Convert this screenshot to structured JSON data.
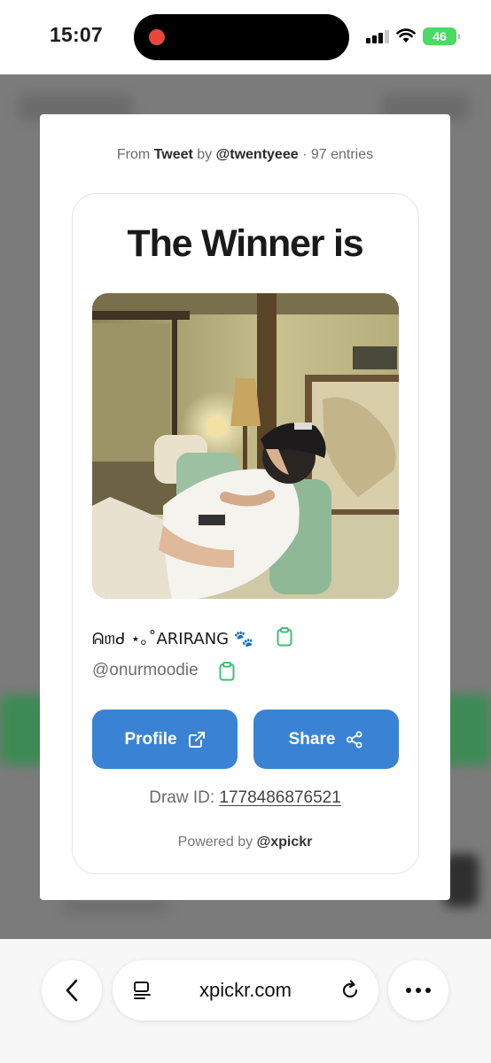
{
  "status_bar": {
    "time": "15:07",
    "battery": "46"
  },
  "modal": {
    "source": {
      "from": "From",
      "platform": "Tweet",
      "by": "by",
      "author": "@twentyeee",
      "entries": "· 97 entries"
    },
    "title": "The Winner is",
    "winner": {
      "display_name": "ᕱᥖᑯ ⋆｡˚ARIRANG 🐾",
      "handle": "@onurmoodie"
    },
    "buttons": {
      "profile": "Profile",
      "share": "Share"
    },
    "draw": {
      "label": "Draw ID:",
      "id": "1778486876521"
    },
    "powered": {
      "label": "Powered by",
      "brand": "@xpickr"
    }
  },
  "browser": {
    "url": "xpickr.com"
  },
  "colors": {
    "accent": "#3a83d4",
    "clipboard": "#3fbf6f",
    "battery": "#4cd964"
  },
  "icons": [
    "clipboard-icon",
    "external-link-icon",
    "share-icon",
    "back-icon",
    "tabs-icon",
    "reload-icon",
    "more-icon"
  ]
}
